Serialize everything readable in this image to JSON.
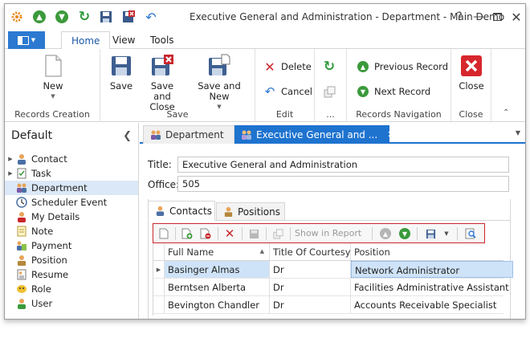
{
  "window": {
    "title": "Executive General and Administration - Department - Main Demo"
  },
  "quick_access": [
    {
      "icon": "app-gear-icon",
      "color": "#e58a1f"
    },
    {
      "icon": "arrow-up-green-icon",
      "color": "#3b9a3b"
    },
    {
      "icon": "arrow-down-green-icon",
      "color": "#3b9a3b"
    },
    {
      "icon": "refresh-icon",
      "color": "#2f9a3a"
    },
    {
      "icon": "save-icon",
      "color": "#3a5a8a"
    },
    {
      "icon": "save-close-icon",
      "color": "#c8262c"
    },
    {
      "icon": "undo-icon",
      "color": "#2b79d0"
    }
  ],
  "ribbon_tabs": {
    "home": "Home",
    "view": "View",
    "tools": "Tools"
  },
  "ribbon": {
    "new_label": "New",
    "records_creation": "Records Creation",
    "save_label": "Save",
    "save_close_line1": "Save and",
    "save_close_line2": "Close",
    "save_new_label": "Save and New",
    "save_group": "Save",
    "delete_label": "Delete",
    "cancel_label": "Cancel",
    "edit_group": "Edit",
    "misc_group": "...",
    "previous_label": "Previous Record",
    "next_label": "Next Record",
    "nav_group": "Records Navigation",
    "close_label": "Close",
    "close_group": "Close"
  },
  "nav": {
    "header": "Default",
    "items": [
      {
        "label": "Contact",
        "icon": "contact-icon",
        "expandable": true
      },
      {
        "label": "Task",
        "icon": "task-icon",
        "expandable": true
      },
      {
        "label": "Department",
        "icon": "department-icon",
        "expandable": false,
        "selected": true
      },
      {
        "label": "Scheduler Event",
        "icon": "scheduler-icon",
        "expandable": false
      },
      {
        "label": "My Details",
        "icon": "my-details-icon",
        "expandable": false
      },
      {
        "label": "Note",
        "icon": "note-icon",
        "expandable": false
      },
      {
        "label": "Payment",
        "icon": "payment-icon",
        "expandable": false
      },
      {
        "label": "Position",
        "icon": "position-icon",
        "expandable": false
      },
      {
        "label": "Resume",
        "icon": "resume-icon",
        "expandable": false
      },
      {
        "label": "Role",
        "icon": "role-icon",
        "expandable": false
      },
      {
        "label": "User",
        "icon": "user-icon",
        "expandable": false
      }
    ]
  },
  "doc_tabs": {
    "tab1": "Department",
    "tab2": "Executive General and ..."
  },
  "form": {
    "title_label": "Title:",
    "title_value": "Executive General and Administration",
    "office_label": "Office:",
    "office_value": "505"
  },
  "inner_tabs": {
    "contacts": "Contacts",
    "positions": "Positions"
  },
  "grid_toolbar": {
    "show_in_report": "Show in Report"
  },
  "grid": {
    "columns": [
      "Full Name",
      "Title Of Courtesy",
      "Position"
    ],
    "rows": [
      [
        "Basinger Almas",
        "Dr",
        "Network Administrator"
      ],
      [
        "Berntsen Alberta",
        "Dr",
        "Facilities Administrative Assistant"
      ],
      [
        "Bevington Chandler",
        "Dr",
        "Accounts Receivable Specialist"
      ]
    ]
  }
}
